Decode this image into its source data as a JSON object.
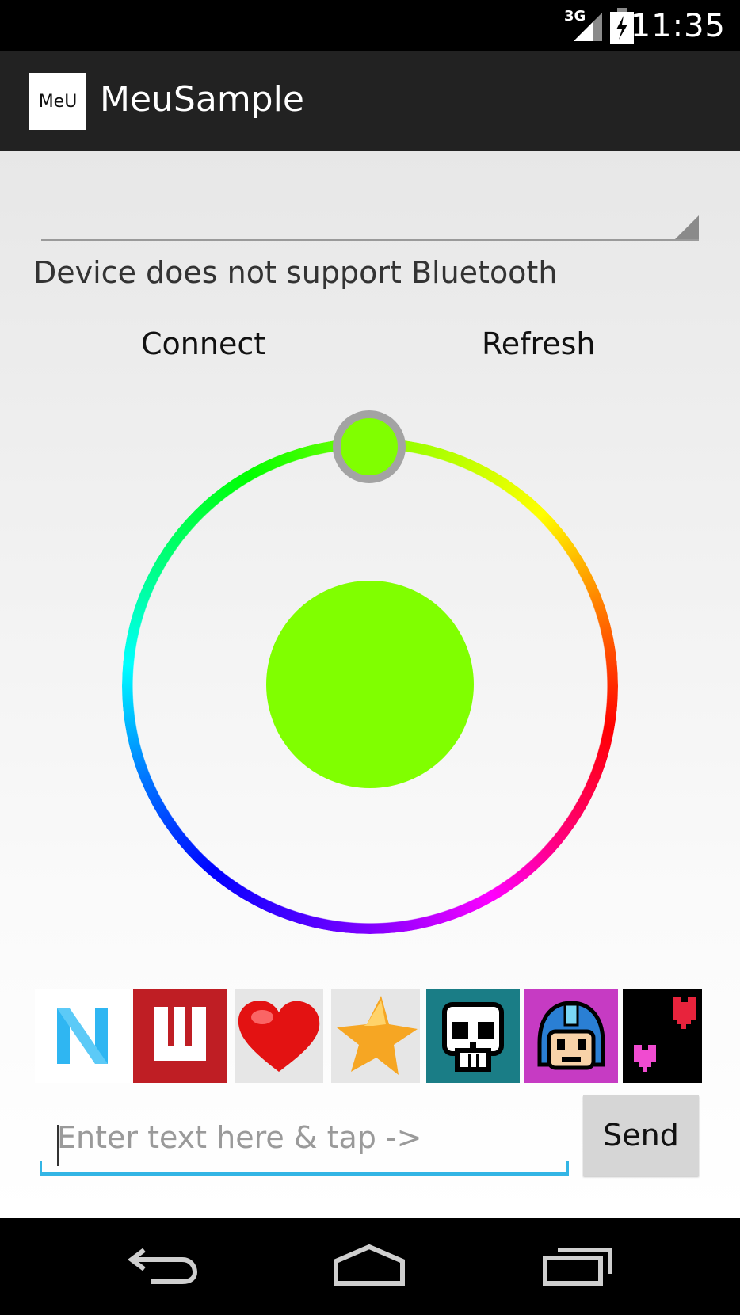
{
  "status_bar": {
    "network": "3G",
    "time": "11:35"
  },
  "action_bar": {
    "app_icon_text": "MeU",
    "title": "MeuSample"
  },
  "main": {
    "status_message": "Device does not support Bluetooth",
    "connect_label": "Connect",
    "refresh_label": "Refresh",
    "color_picker": {
      "selected_color": "#80ff00",
      "ring_color": "#a3a3a3"
    },
    "icons": [
      "n-logo-icon",
      "wiiu-logo-icon",
      "heart-icon",
      "star-icon",
      "skull-icon",
      "megaman-icon",
      "pixel-hearts-icon"
    ],
    "text_input": {
      "placeholder": "Enter text here & tap ->",
      "value": ""
    },
    "send_label": "Send"
  },
  "nav_bar": {
    "buttons": [
      "back-icon",
      "home-icon",
      "recent-apps-icon"
    ]
  },
  "colors": {
    "action_bar": "#222222",
    "accent": "#33b5e5"
  }
}
